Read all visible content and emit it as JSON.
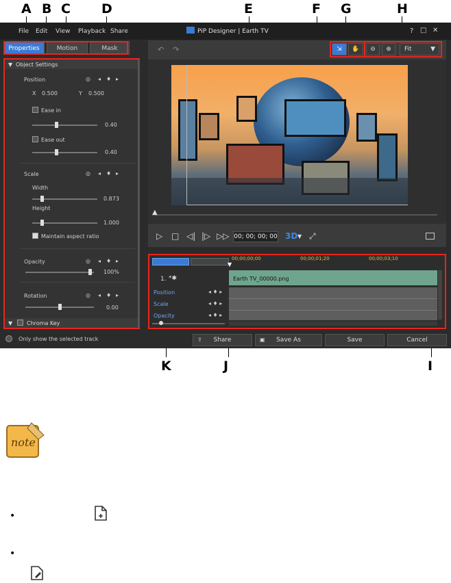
{
  "callouts": [
    "A",
    "B",
    "C",
    "D",
    "E",
    "F",
    "G",
    "H",
    "I",
    "J",
    "K"
  ],
  "app": {
    "title": "PiP Designer  |  Earth TV",
    "menu": [
      "File",
      "Edit",
      "View",
      "Playback",
      "Share"
    ],
    "window_buttons": [
      "?",
      "□",
      "✕"
    ],
    "tabs": [
      "Properties",
      "Motion",
      "Mask"
    ],
    "panel": {
      "section_title": "Object Settings",
      "position_label": "Position",
      "x_label": "X",
      "x_value": "0.500",
      "y_label": "Y",
      "y_value": "0.500",
      "ease_in_label": "Ease in",
      "ease_in_value": "0.40",
      "ease_out_label": "Ease out",
      "ease_out_value": "0.40",
      "scale_label": "Scale",
      "width_label": "Width",
      "width_value": "0.873",
      "height_label": "Height",
      "height_value": "1.000",
      "maintain_label": "Maintain aspect ratio",
      "opacity_label": "Opacity",
      "opacity_value": "100%",
      "rotation_label": "Rotation",
      "rotation_value": "0.00",
      "chroma_label": "Chroma Key"
    },
    "only_show_label": "Only show the selected track",
    "zoom_select": "Fit",
    "timecode": "00; 00; 00; 00",
    "three_d": "3D",
    "timeline": {
      "ruler": [
        "00;00;00;00",
        "00;00;01;20",
        "00;00;03;10"
      ],
      "track_number": "1.",
      "clip_name": "Earth TV_00000.png",
      "rows": [
        "Position",
        "Scale",
        "Opacity"
      ]
    },
    "buttons": {
      "share": "Share",
      "save_as": "Save As",
      "save": "Save",
      "cancel": "Cancel"
    }
  },
  "colors": {
    "accent": "#3a7bd5",
    "highlight_border": "#e8261e",
    "clip": "#6fa58f"
  }
}
